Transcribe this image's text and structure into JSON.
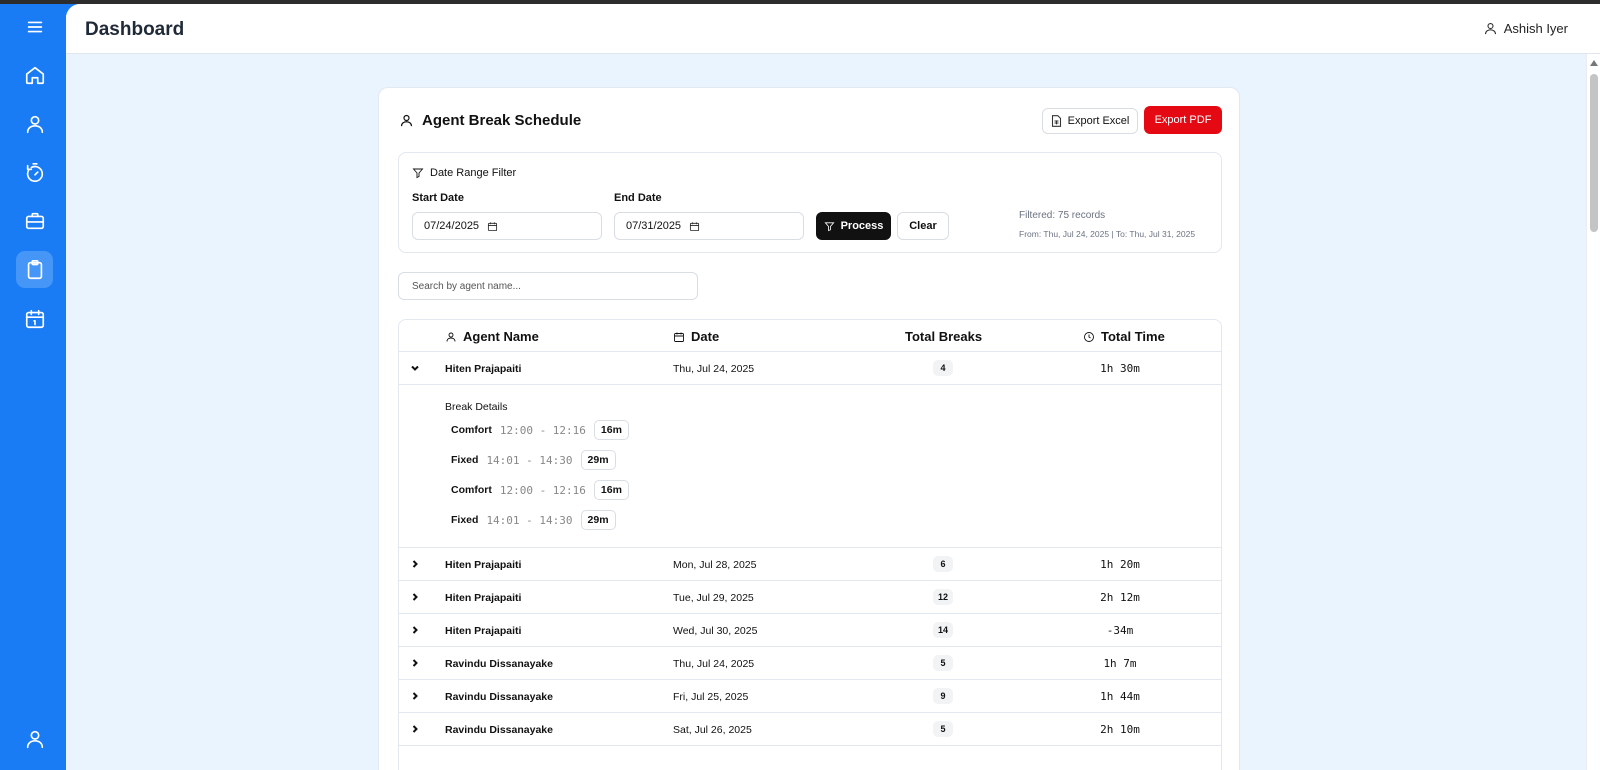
{
  "header": {
    "title": "Dashboard",
    "user_name": "Ashish Iyer"
  },
  "sidebar": {
    "items": [
      {
        "icon": "menu-icon"
      },
      {
        "icon": "home-icon"
      },
      {
        "icon": "user-icon"
      },
      {
        "icon": "timer-icon"
      },
      {
        "icon": "briefcase-icon"
      },
      {
        "icon": "clipboard-icon",
        "active": true
      },
      {
        "icon": "calendar-icon"
      },
      {
        "icon": "profile-icon"
      }
    ]
  },
  "card": {
    "title": "Agent Break Schedule",
    "export_excel_label": "Export Excel",
    "export_pdf_label": "Export PDF",
    "accent_color": "#e50914"
  },
  "filter": {
    "heading": "Date Range Filter",
    "start_label": "Start Date",
    "start_value": "07/24/2025",
    "end_label": "End Date",
    "end_value": "07/31/2025",
    "process_label": "Process",
    "clear_label": "Clear",
    "filtered_text": "Filtered: 75 records",
    "range_text": "From: Thu, Jul 24, 2025 | To: Thu, Jul 31, 2025"
  },
  "search": {
    "placeholder": "Search by agent name..."
  },
  "table": {
    "columns": {
      "agent_name": "Agent Name",
      "date": "Date",
      "total_breaks": "Total Breaks",
      "total_time": "Total Time"
    },
    "expanded_row": {
      "name": "Hiten Prajapaiti",
      "date": "Thu, Jul 24, 2025",
      "breaks": "4",
      "time": "1h 30m",
      "details_title": "Break Details",
      "details": [
        {
          "type": "Comfort",
          "range": "12:00 - 12:16",
          "duration": "16m"
        },
        {
          "type": "Fixed",
          "range": "14:01 - 14:30",
          "duration": "29m"
        },
        {
          "type": "Comfort",
          "range": "12:00 - 12:16",
          "duration": "16m"
        },
        {
          "type": "Fixed",
          "range": "14:01 - 14:30",
          "duration": "29m"
        }
      ]
    },
    "rows": [
      {
        "name": "Hiten Prajapaiti",
        "date": "Mon, Jul 28, 2025",
        "breaks": "6",
        "time": "1h 20m"
      },
      {
        "name": "Hiten Prajapaiti",
        "date": "Tue, Jul 29, 2025",
        "breaks": "12",
        "time": "2h 12m"
      },
      {
        "name": "Hiten Prajapaiti",
        "date": "Wed, Jul 30, 2025",
        "breaks": "14",
        "time": "-34m"
      },
      {
        "name": "Ravindu Dissanayake",
        "date": "Thu, Jul 24, 2025",
        "breaks": "5",
        "time": "1h 7m"
      },
      {
        "name": "Ravindu Dissanayake",
        "date": "Fri, Jul 25, 2025",
        "breaks": "9",
        "time": "1h 44m"
      },
      {
        "name": "Ravindu Dissanayake",
        "date": "Sat, Jul 26, 2025",
        "breaks": "5",
        "time": "2h 10m"
      }
    ]
  }
}
